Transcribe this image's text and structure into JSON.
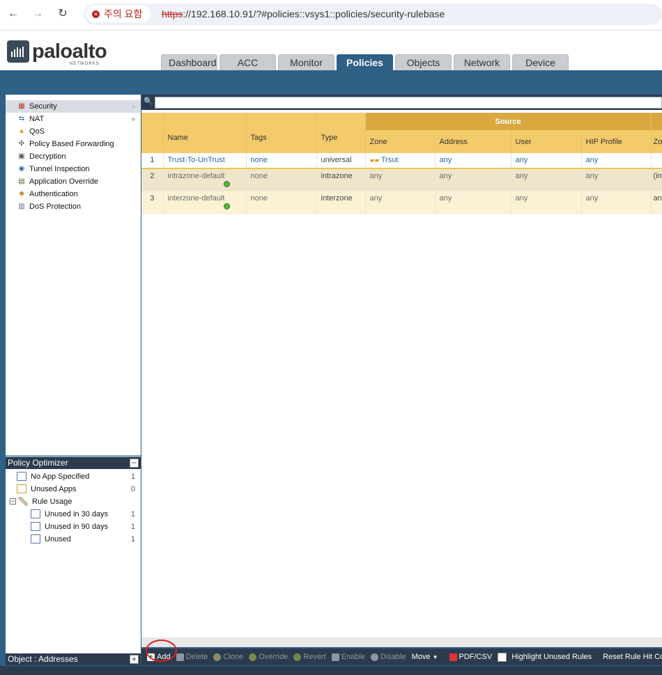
{
  "browser": {
    "warning": "주의 요함",
    "url_scheme": "https",
    "url_rest": "://192.168.10.91/?#policies::vsys1::policies/security-rulebase"
  },
  "logo": {
    "word": "paloalto",
    "sub": "NETWORKS"
  },
  "tabs": [
    "Dashboard",
    "ACC",
    "Monitor",
    "Policies",
    "Objects",
    "Network",
    "Device"
  ],
  "active_tab": "Policies",
  "policy_tree": [
    {
      "label": "Security",
      "icon": "firewall-icon",
      "selected": true
    },
    {
      "label": "NAT",
      "icon": "nat-icon"
    },
    {
      "label": "QoS",
      "icon": "qos-icon"
    },
    {
      "label": "Policy Based Forwarding",
      "icon": "pbf-icon"
    },
    {
      "label": "Decryption",
      "icon": "lock-icon"
    },
    {
      "label": "Tunnel Inspection",
      "icon": "tunnel-icon"
    },
    {
      "label": "Application Override",
      "icon": "app-override-icon"
    },
    {
      "label": "Authentication",
      "icon": "users-icon"
    },
    {
      "label": "DoS Protection",
      "icon": "dos-icon"
    }
  ],
  "optimizer": {
    "title": "Policy Optimizer",
    "items": [
      {
        "label": "No App Specified",
        "count": "1"
      },
      {
        "label": "Unused Apps",
        "count": "0"
      },
      {
        "label": "Rule Usage",
        "count": ""
      },
      {
        "label": "Unused in 30 days",
        "count": "1"
      },
      {
        "label": "Unused in 90 days",
        "count": "1"
      },
      {
        "label": "Unused",
        "count": "1"
      }
    ]
  },
  "object_panel": {
    "title": "Object : Addresses"
  },
  "table": {
    "group_header": "Source",
    "columns": [
      "",
      "Name",
      "Tags",
      "Type",
      "Zone",
      "Address",
      "User",
      "HIP Profile",
      "Zo"
    ],
    "rows": [
      {
        "num": "1",
        "name": "Trust-To-UnTrust",
        "tags": "none",
        "type": "universal",
        "zone": "Trsut",
        "address": "any",
        "user": "any",
        "hip": "any",
        "dzone": ""
      },
      {
        "num": "2",
        "name": "intrazone-default",
        "tags": "none",
        "type": "intrazone",
        "zone": "any",
        "address": "any",
        "user": "any",
        "hip": "any",
        "dzone": "(in"
      },
      {
        "num": "3",
        "name": "interzone-default",
        "tags": "none",
        "type": "interzone",
        "zone": "any",
        "address": "any",
        "user": "any",
        "hip": "any",
        "dzone": "an"
      }
    ]
  },
  "toolbar": {
    "add": "Add",
    "delete": "Delete",
    "clone": "Clone",
    "override": "Override",
    "revert": "Revert",
    "enable": "Enable",
    "disable": "Disable",
    "move": "Move",
    "pdf": "PDF/CSV",
    "highlight": "Highlight Unused Rules",
    "reset": "Reset Rule Hit Counter"
  },
  "colors": {
    "accent": "#2f6086",
    "header_yellow": "#f4cb6a",
    "group_gold": "#d9a83f",
    "dark_bar": "#2b3b4d"
  }
}
